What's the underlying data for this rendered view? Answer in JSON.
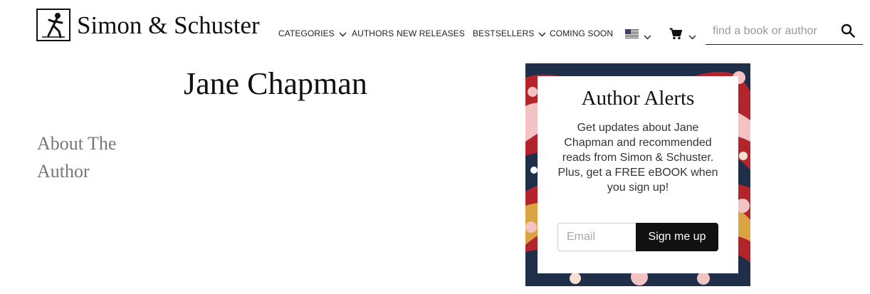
{
  "header": {
    "brand": "Simon & Schuster",
    "nav": {
      "categories": "CATEGORIES",
      "authors": "AUTHORS",
      "new_releases": "NEW RELEASES",
      "bestsellers": "BESTSELLERS",
      "coming_soon": "COMING SOON"
    },
    "region_icon": "us-flag-icon",
    "cart_icon": "cart-icon",
    "search": {
      "placeholder": "find a book or author",
      "value": ""
    }
  },
  "main": {
    "author_name": "Jane Chapman",
    "about_heading": "About The Author"
  },
  "alerts": {
    "title": "Author Alerts",
    "body": "Get updates about Jane Chapman and recommended reads from Simon & Schuster. Plus, get a FREE eBOOK when you sign up!",
    "email_placeholder": "Email",
    "button_label": "Sign me up"
  },
  "colors": {
    "text": "#111111",
    "muted_heading": "#777777",
    "button_bg": "#111111",
    "marble_red": "#b3252b",
    "marble_navy": "#1f2f4a",
    "marble_pink": "#f3c3c3",
    "marble_gold": "#d9a441"
  }
}
